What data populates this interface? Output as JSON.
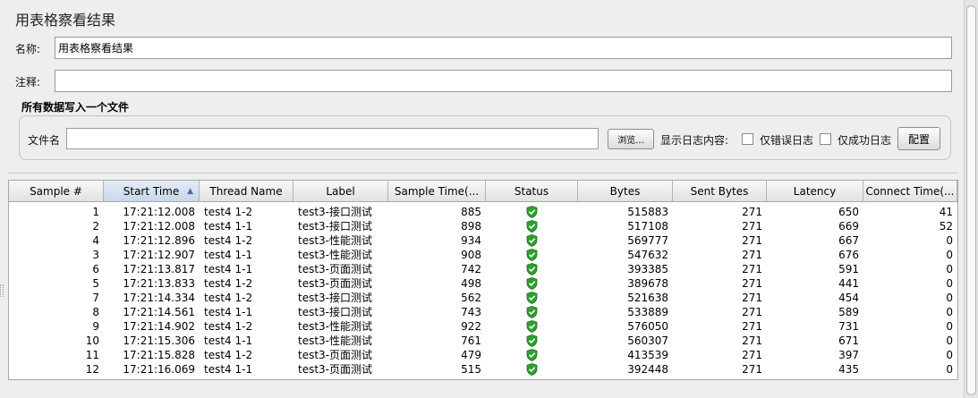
{
  "page": {
    "title": "用表格察看结果"
  },
  "form": {
    "name_label": "名称:",
    "name_value": "用表格察看结果",
    "comment_label": "注释:",
    "comment_value": ""
  },
  "file_group": {
    "title": "所有数据写入一个文件",
    "filename_label": "文件名",
    "filename_value": "",
    "browse_label": "浏览...",
    "log_content_label": "显示日志内容:",
    "errors_only_label": "仅错误日志",
    "errors_only_checked": false,
    "success_only_label": "仅成功日志",
    "success_only_checked": false,
    "configure_label": "配置"
  },
  "table": {
    "sorted_column": "Start Time",
    "sort_direction": "ascending",
    "columns": [
      "Sample #",
      "Start Time",
      "Thread Name",
      "Label",
      "Sample Time(...",
      "Status",
      "Bytes",
      "Sent Bytes",
      "Latency",
      "Connect Time(..."
    ],
    "rows": [
      {
        "sample": "1",
        "start": "17:21:12.008",
        "thread": "test4 1-2",
        "label": "test3-接口测试",
        "sample_time": "885",
        "status": "success",
        "bytes": "515883",
        "sent": "271",
        "latency": "650",
        "connect": "41"
      },
      {
        "sample": "2",
        "start": "17:21:12.008",
        "thread": "test4 1-1",
        "label": "test3-接口测试",
        "sample_time": "898",
        "status": "success",
        "bytes": "517108",
        "sent": "271",
        "latency": "669",
        "connect": "52"
      },
      {
        "sample": "4",
        "start": "17:21:12.896",
        "thread": "test4 1-2",
        "label": "test3-性能测试",
        "sample_time": "934",
        "status": "success",
        "bytes": "569777",
        "sent": "271",
        "latency": "667",
        "connect": "0"
      },
      {
        "sample": "3",
        "start": "17:21:12.907",
        "thread": "test4 1-1",
        "label": "test3-性能测试",
        "sample_time": "908",
        "status": "success",
        "bytes": "547632",
        "sent": "271",
        "latency": "676",
        "connect": "0"
      },
      {
        "sample": "6",
        "start": "17:21:13.817",
        "thread": "test4 1-1",
        "label": "test3-页面测试",
        "sample_time": "742",
        "status": "success",
        "bytes": "393385",
        "sent": "271",
        "latency": "591",
        "connect": "0"
      },
      {
        "sample": "5",
        "start": "17:21:13.833",
        "thread": "test4 1-2",
        "label": "test3-页面测试",
        "sample_time": "498",
        "status": "success",
        "bytes": "389678",
        "sent": "271",
        "latency": "441",
        "connect": "0"
      },
      {
        "sample": "7",
        "start": "17:21:14.334",
        "thread": "test4 1-2",
        "label": "test3-接口测试",
        "sample_time": "562",
        "status": "success",
        "bytes": "521638",
        "sent": "271",
        "latency": "454",
        "connect": "0"
      },
      {
        "sample": "8",
        "start": "17:21:14.561",
        "thread": "test4 1-1",
        "label": "test3-接口测试",
        "sample_time": "743",
        "status": "success",
        "bytes": "533889",
        "sent": "271",
        "latency": "589",
        "connect": "0"
      },
      {
        "sample": "9",
        "start": "17:21:14.902",
        "thread": "test4 1-2",
        "label": "test3-性能测试",
        "sample_time": "922",
        "status": "success",
        "bytes": "576050",
        "sent": "271",
        "latency": "731",
        "connect": "0"
      },
      {
        "sample": "10",
        "start": "17:21:15.306",
        "thread": "test4 1-1",
        "label": "test3-性能测试",
        "sample_time": "761",
        "status": "success",
        "bytes": "560307",
        "sent": "271",
        "latency": "671",
        "connect": "0"
      },
      {
        "sample": "11",
        "start": "17:21:15.828",
        "thread": "test4 1-2",
        "label": "test3-页面测试",
        "sample_time": "479",
        "status": "success",
        "bytes": "413539",
        "sent": "271",
        "latency": "397",
        "connect": "0"
      },
      {
        "sample": "12",
        "start": "17:21:16.069",
        "thread": "test4 1-1",
        "label": "test3-页面测试",
        "sample_time": "515",
        "status": "success",
        "bytes": "392448",
        "sent": "271",
        "latency": "435",
        "connect": "0"
      }
    ]
  },
  "icons": {
    "status_success": "green-shield-check-icon"
  },
  "colors": {
    "status_success": "#2ea02e",
    "sorted_header": "#c9d7ea"
  }
}
